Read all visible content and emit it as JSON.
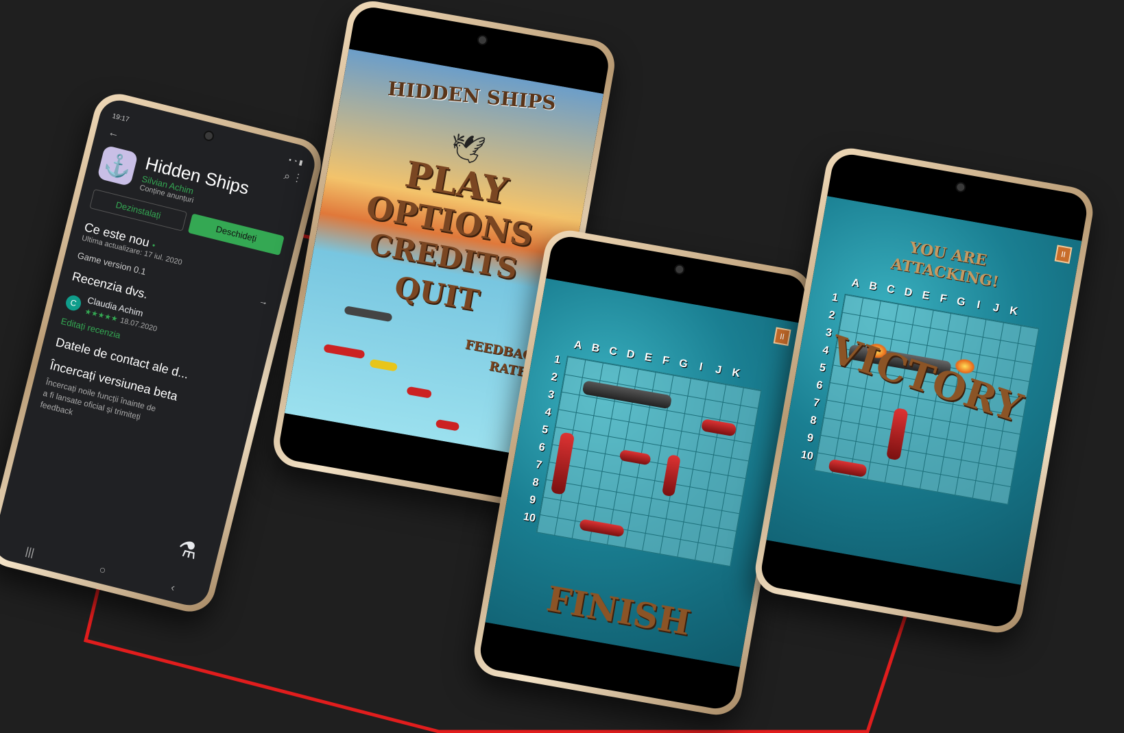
{
  "colors": {
    "background": "#1f1f1f",
    "connector": "#e11d1d",
    "accent_green": "#34a853",
    "title_brown": "#7a4622"
  },
  "store": {
    "status_time": "19:17",
    "app_title": "Hidden Ships",
    "developer": "Silvian Achim",
    "ads_note": "Conține anunțuri",
    "uninstall_label": "Dezinstalați",
    "open_label": "Deschideți",
    "whats_new_title": "Ce este nou",
    "whats_new_dot": "•",
    "last_update": "Ultima actualizare: 17 iul. 2020",
    "version": "Game version 0.1",
    "arrow": "→",
    "review_title": "Recenzia dvs.",
    "reviewer_initial": "C",
    "reviewer_name": "Claudia Achim",
    "review_stars": "★★★★★",
    "review_date": "18.07.2020",
    "edit_review": "Editați recenzia",
    "contact_title": "Datele de contact ale d...",
    "beta_title": "Încercați versiunea beta",
    "beta_text": "Încercați noile funcții înainte de a fi lansate oficial și trimiteți feedback",
    "nav_recent": "|||",
    "nav_home": "○",
    "nav_back": "‹",
    "back_icon": "←",
    "search_icon": "⌕",
    "more_icon": "⋮"
  },
  "menu": {
    "title": "HIDDEN SHIPS",
    "play": "PLAY",
    "options": "OPTIONS",
    "credits": "CREDITS",
    "quit": "QUIT",
    "feedback": "FEEDBACK",
    "rate": "RATE"
  },
  "board": {
    "columns": [
      "A",
      "B",
      "C",
      "D",
      "E",
      "F",
      "G",
      "I",
      "J",
      "K"
    ],
    "rows": [
      "1",
      "2",
      "3",
      "4",
      "5",
      "6",
      "7",
      "8",
      "9",
      "10"
    ],
    "finish": "FINISH",
    "pause": "II"
  },
  "attack": {
    "heading_line1": "YOU ARE",
    "heading_line2": "ATTACKING!",
    "result": "VICTORY",
    "pause": "II"
  }
}
